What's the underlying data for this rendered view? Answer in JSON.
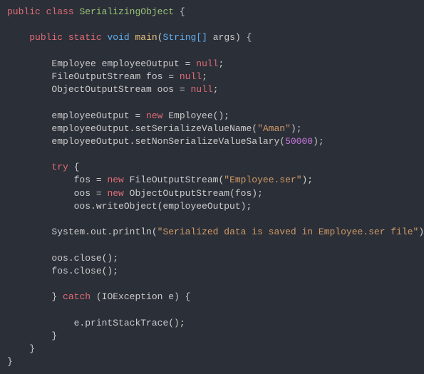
{
  "code": {
    "l1": {
      "kw1": "public",
      "kw2": "class",
      "name": "SerializingObject",
      "brace": " {"
    },
    "l2": "",
    "l3": {
      "indent": "    ",
      "kw1": "public",
      "kw2": "static",
      "kw3": "void",
      "fn": "main",
      "lparen": "(",
      "type": "String[]",
      "arg": " args",
      "rparen": ")",
      "brace": " {"
    },
    "l4": "",
    "l5": {
      "indent": "        ",
      "text": "Employee employeeOutput = ",
      "null": "null",
      "end": ";"
    },
    "l6": {
      "indent": "        ",
      "text": "FileOutputStream fos = ",
      "null": "null",
      "end": ";"
    },
    "l7": {
      "indent": "        ",
      "text": "ObjectOutputStream oos = ",
      "null": "null",
      "end": ";"
    },
    "l8": "",
    "l9": {
      "indent": "        ",
      "text1": "employeeOutput = ",
      "new": "new",
      "text2": " Employee();"
    },
    "l10": {
      "indent": "        ",
      "text1": "employeeOutput.setSerializeValueName(",
      "str": "\"Aman\"",
      "text2": ");"
    },
    "l11": {
      "indent": "        ",
      "text1": "employeeOutput.setNonSerializeValueSalary(",
      "num": "50000",
      "text2": ");"
    },
    "l12": "",
    "l13": {
      "indent": "        ",
      "try": "try",
      "brace": " {"
    },
    "l14": {
      "indent": "            ",
      "text1": "fos = ",
      "new": "new",
      "text2": " FileOutputStream(",
      "str": "\"Employee.ser\"",
      "text3": ");"
    },
    "l15": {
      "indent": "            ",
      "text1": "oos = ",
      "new": "new",
      "text2": " ObjectOutputStream(fos);"
    },
    "l16": {
      "indent": "            ",
      "text": "oos.writeObject(employeeOutput);"
    },
    "l17": "",
    "l18": {
      "indent": "        ",
      "text1": "System.out.println(",
      "str": "\"Serialized data is saved in Employee.ser file\"",
      "text2": ");"
    },
    "l19": "",
    "l20": {
      "indent": "        ",
      "text": "oos.close();"
    },
    "l21": {
      "indent": "        ",
      "text": "fos.close();"
    },
    "l22": "",
    "l23": {
      "indent": "        ",
      "brace1": "}",
      "catch": " catch",
      "text": " (IOException e) {"
    },
    "l24": "",
    "l25": {
      "indent": "            ",
      "text": "e.printStackTrace();"
    },
    "l26": {
      "indent": "        ",
      "brace": "}"
    },
    "l27": {
      "indent": "    ",
      "brace": "}"
    },
    "l28": {
      "indent": "",
      "brace": "}"
    }
  }
}
